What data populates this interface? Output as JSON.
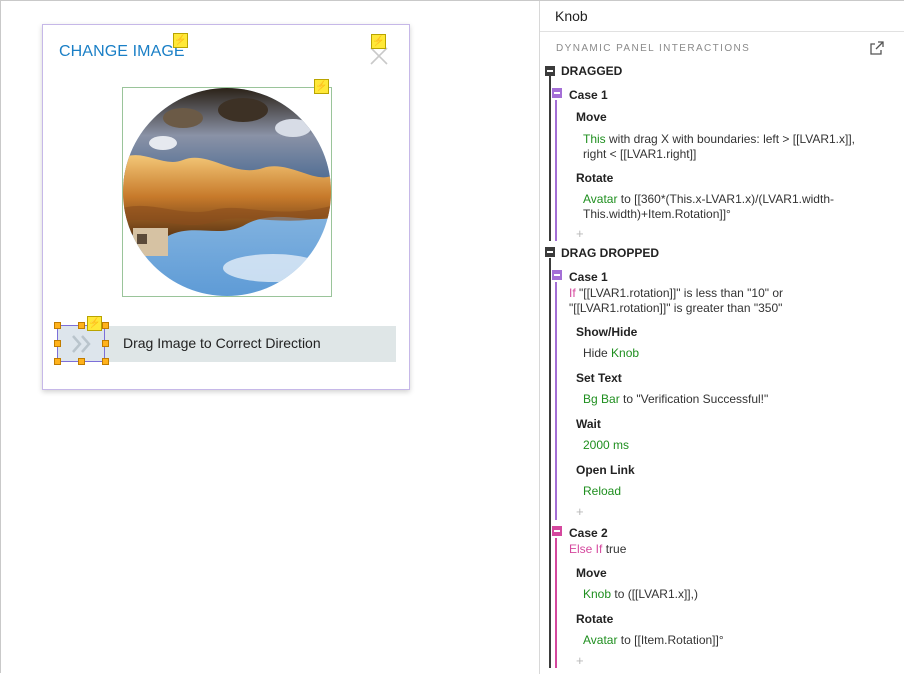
{
  "canvas": {
    "change_image_label": "CHANGE IMAGE",
    "bar_label": "Drag Image to Correct Direction"
  },
  "panel": {
    "header_title": "Knob",
    "section_title": "DYNAMIC PANEL INTERACTIONS",
    "events": [
      {
        "name": "DRAGGED",
        "cases": [
          {
            "title": "Case 1",
            "actions": [
              {
                "name": "Move",
                "target": "This",
                "detail_1": " with drag X  with boundaries: left > [[LVAR1.x]],",
                "detail_2": "right < [[LVAR1.right]]"
              },
              {
                "name": "Rotate",
                "target": "Avatar",
                "detail_1": " to [[360*(This.x-LVAR1.x)/(LVAR1.width-",
                "detail_2": "This.width)+Item.Rotation]]°"
              }
            ],
            "add": "+"
          }
        ]
      },
      {
        "name": "DRAG DROPPED",
        "cases": [
          {
            "title": "Case 1",
            "cond_keyword": "If",
            "cond_1": " \"[[LVAR1.rotation]]\" is less than \"10\" or",
            "cond_2": "\"[[LVAR1.rotation]]\" is greater than \"350\"",
            "actions": [
              {
                "name": "Show/Hide",
                "prefix": "Hide ",
                "target": "Knob"
              },
              {
                "name": "Set Text",
                "target": "Bg Bar",
                "detail": " to \"Verification Successful!\""
              },
              {
                "name": "Wait",
                "target": "2000 ms"
              },
              {
                "name": "Open Link",
                "target": "Reload"
              }
            ],
            "add": "+"
          },
          {
            "title": "Case 2",
            "cond_keyword": "Else If",
            "cond_1": " true",
            "actions": [
              {
                "name": "Move",
                "target": "Knob",
                "detail": " to ([[LVAR1.x]],)"
              },
              {
                "name": "Rotate",
                "target": "Avatar",
                "detail": " to [[Item.Rotation]]°"
              }
            ],
            "add": "+"
          }
        ]
      }
    ]
  },
  "colors": {
    "accent_blue": "#1a7fc6",
    "action_green": "#1f8f1f",
    "case_purple": "#a46fd6",
    "case_pink": "#d5489e",
    "bolt_yellow": "#ffe838",
    "handle_orange": "#ffb21c"
  },
  "icons": [
    "lightning-icon",
    "close-icon",
    "chevron-right-icon",
    "popout-icon",
    "collapse-icon"
  ]
}
